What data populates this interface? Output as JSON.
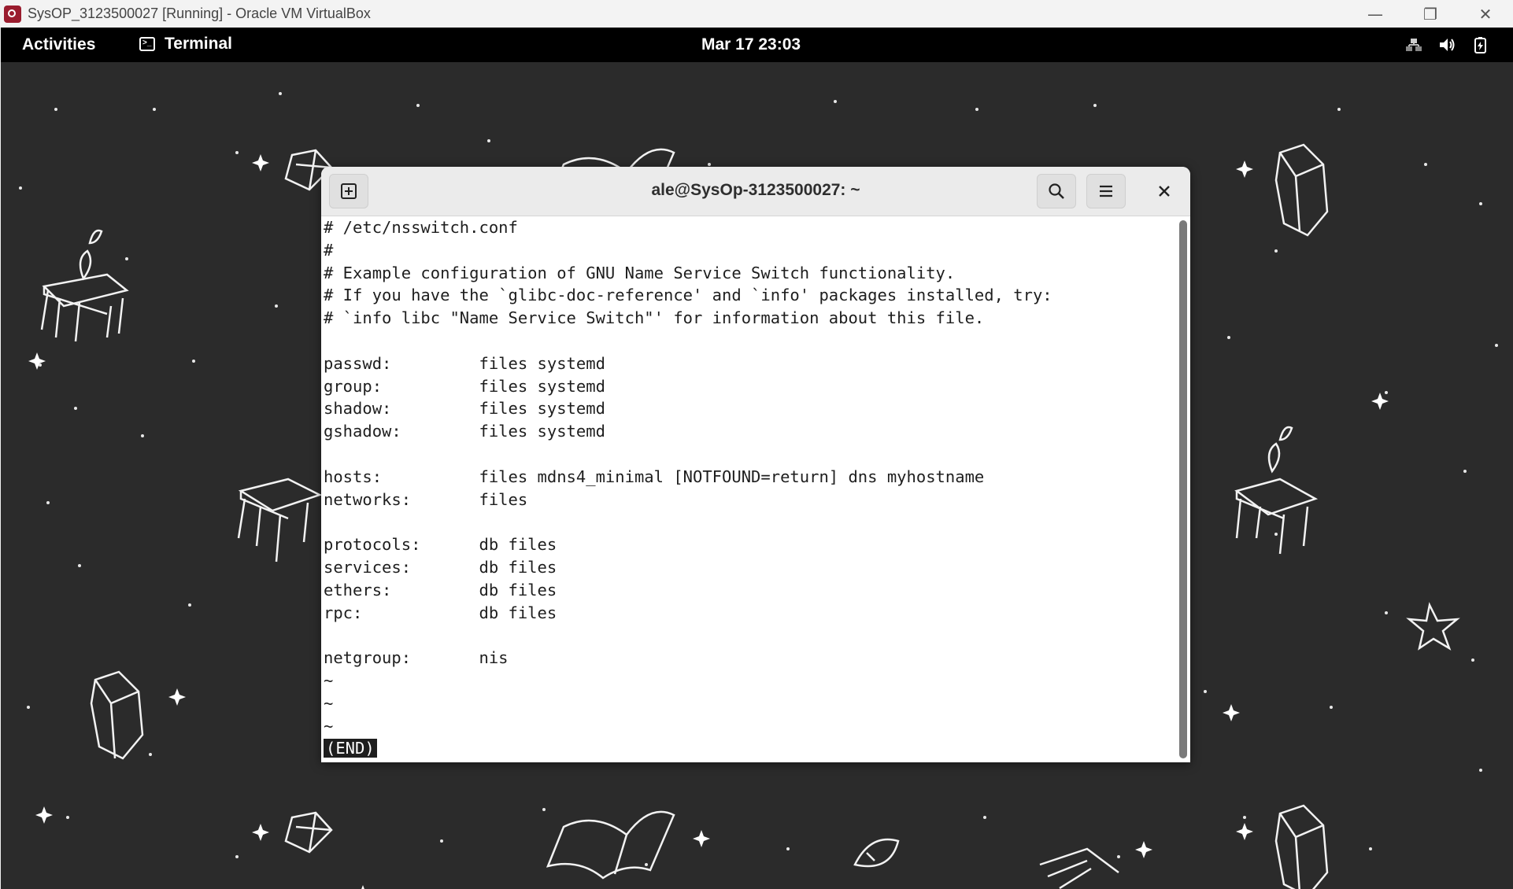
{
  "host_window": {
    "title": "SysOP_3123500027 [Running] - Oracle VM VirtualBox",
    "controls": {
      "minimize": "—",
      "restore": "❐",
      "close": "✕"
    }
  },
  "gnome_bar": {
    "activities": "Activities",
    "app_name": "Terminal",
    "clock": "Mar 17  23:03"
  },
  "terminal": {
    "title": "ale@SysOp-3123500027: ~",
    "lines": [
      "# /etc/nsswitch.conf",
      "#",
      "# Example configuration of GNU Name Service Switch functionality.",
      "# If you have the `glibc-doc-reference' and `info' packages installed, try:",
      "# `info libc \"Name Service Switch\"' for information about this file.",
      "",
      "passwd:         files systemd",
      "group:          files systemd",
      "shadow:         files systemd",
      "gshadow:        files systemd",
      "",
      "hosts:          files mdns4_minimal [NOTFOUND=return] dns myhostname",
      "networks:       files",
      "",
      "protocols:      db files",
      "services:       db files",
      "ethers:         db files",
      "rpc:            db files",
      "",
      "netgroup:       nis",
      "~",
      "~",
      "~"
    ],
    "end_marker": "(END)"
  }
}
